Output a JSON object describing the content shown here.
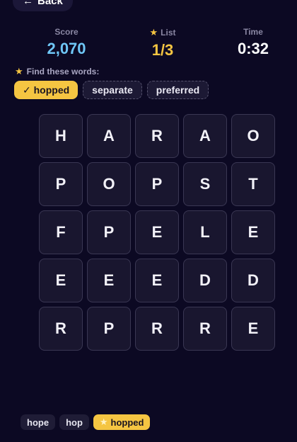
{
  "nav": {
    "back_label": "Back"
  },
  "stats": {
    "score_label": "Score",
    "score_value": "2,070",
    "list_label": "List",
    "list_value": "1/3",
    "time_label": "Time",
    "time_value": "0:32"
  },
  "colors": {
    "score": "#6fc7f7",
    "list": "#f5c542",
    "time": "#ffffff",
    "accent": "#f5c542",
    "background": "#0c0923"
  },
  "targets": {
    "title": "Find these words:",
    "items": [
      {
        "label": "hopped",
        "found": true
      },
      {
        "label": "separate",
        "found": false
      },
      {
        "label": "preferred",
        "found": false
      }
    ]
  },
  "grid": {
    "rows": [
      [
        "H",
        "A",
        "R",
        "A",
        "O"
      ],
      [
        "P",
        "O",
        "P",
        "S",
        "T"
      ],
      [
        "F",
        "P",
        "E",
        "L",
        "E"
      ],
      [
        "E",
        "E",
        "E",
        "D",
        "D"
      ],
      [
        "R",
        "P",
        "R",
        "R",
        "E"
      ]
    ]
  },
  "found_words": [
    {
      "label": "hope",
      "latest": false
    },
    {
      "label": "hop",
      "latest": false
    },
    {
      "label": "hopped",
      "latest": true
    }
  ],
  "icons": {
    "back": "arrow-left-icon",
    "star": "star-icon",
    "check": "check-icon"
  }
}
